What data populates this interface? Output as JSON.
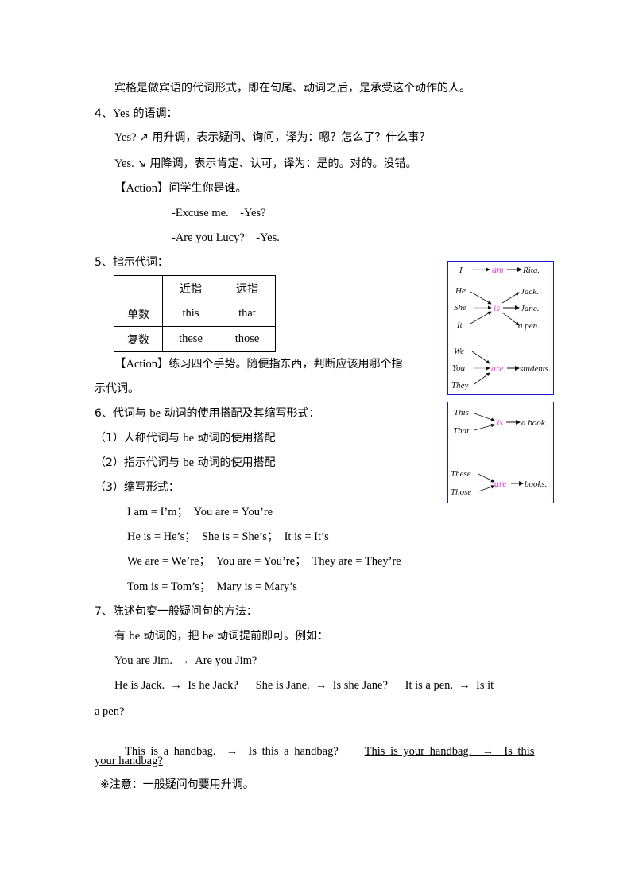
{
  "page": {
    "lines": {
      "l1": "宾格是做宾语的代词形式，即在句尾、动词之后，是承受这个动作的人。",
      "s4_num": "4、",
      "s4_en": "Yes",
      "s4_cn": " 的语调：",
      "yes_up_en": "Yes? ",
      "yes_up_arrow": "↗",
      "yes_up_cn": " 用升调，表示疑问、询问，译为：嗯？怎么了？什么事？",
      "yes_down_en": "Yes. ",
      "yes_down_arrow": "↘",
      "yes_down_cn": " 用降调，表示肯定、认可，译为：是的。对的。没错。",
      "action1_tag": "【Action】",
      "action1_cn": "问学生你是谁。",
      "dialog1": "-Excuse me.    -Yes?",
      "dialog2": "-Are you Lucy?    -Yes.",
      "s5": "5、指示代词：",
      "action2_tag": "【Action】",
      "action2_cn": "练习四个手势。随便指东西，判断应该用哪个指",
      "action2_cont": "示代词。",
      "s6_a": "6、代词与 ",
      "s6_be": "be",
      "s6_b": " 动词的使用搭配及其缩写形式：",
      "s6_1a": "（1）人称代词与 ",
      "s6_1be": "be",
      "s6_1b": " 动词的使用搭配",
      "s6_2a": "（2）指示代词与 ",
      "s6_2be": "be",
      "s6_2b": " 动词的使用搭配",
      "s6_3": "（3）缩写形式：",
      "c1": "I am = I’m；  You are = You’re",
      "c2": "He is = He’s；  She is = She’s；  It is = It’s",
      "c3": "We are = We’re；  You are = You’re；  They are = They’re",
      "c4": "Tom is = Tom’s；  Mary is = Mary’s",
      "s7": "7、陈述句变一般疑问句的方法：",
      "s7_rule_a": "有 ",
      "s7_rule_be1": "be",
      "s7_rule_b": " 动词的，把 ",
      "s7_rule_be2": "be",
      "s7_rule_c": " 动词提前即可。例如：",
      "ex1": "You are Jim.  →  Are you Jim?",
      "ex2": "He is Jack.  →  Is he Jack?      She is Jane.  →  Is she Jane?      It is a pen.  →  Is it",
      "ex2_cont": "a pen?",
      "ex3_plain": "This is a handbag.  →  Is this a handbag?     ",
      "ex3_underlined": "This is your handbag.  →  Is this",
      "ex3_cont": "your handbag?",
      "note": "※注意：一般疑问句要用升调。"
    },
    "table": {
      "header": [
        "",
        "近指",
        "远指"
      ],
      "rows": [
        [
          "单数",
          "this",
          "that"
        ],
        [
          "复数",
          "these",
          "those"
        ]
      ]
    },
    "diagram_personal": {
      "subjects_am": [
        "I"
      ],
      "verb_am": "am",
      "objects_am": [
        "Rita."
      ],
      "subjects_is": [
        "He",
        "She",
        "It"
      ],
      "verb_is": "is",
      "objects_is": [
        "Jack.",
        "Jane.",
        "a pen."
      ],
      "subjects_are": [
        "We",
        "You",
        "They"
      ],
      "verb_are": "are",
      "objects_are": [
        "students."
      ]
    },
    "diagram_demonstrative": {
      "subjects_is": [
        "This",
        "That"
      ],
      "verb_is": "is",
      "object_is": "a book.",
      "subjects_are": [
        "These",
        "Those"
      ],
      "verb_are": "are",
      "object_are": "books."
    },
    "colors": {
      "box_border": "#1a1ad6",
      "verb_highlight": "#ee3ee8"
    }
  }
}
